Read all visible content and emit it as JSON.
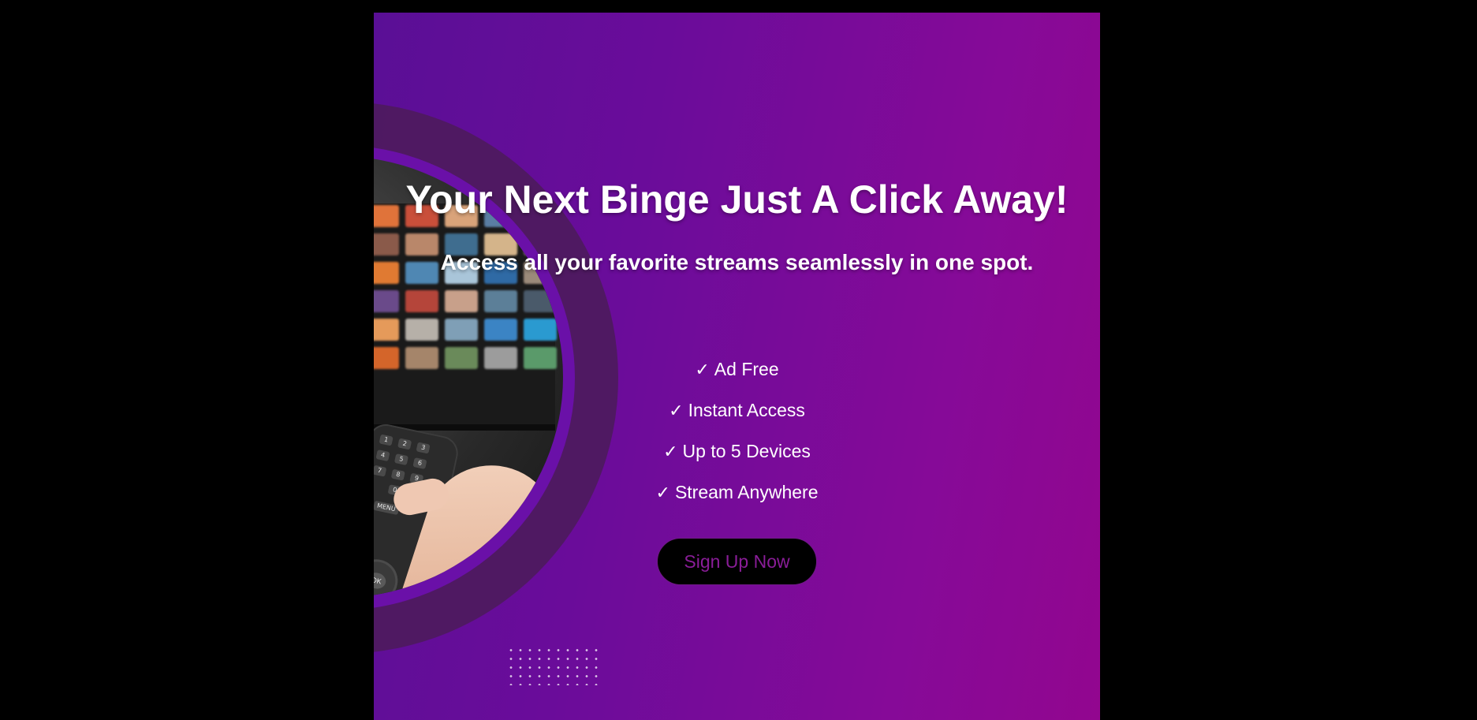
{
  "banner": {
    "headline": "Your Next Binge Just A Click Away!",
    "subheadline": "Access all your favorite streams seamlessly in one spot.",
    "features": [
      {
        "check": "✓",
        "label": "Ad Free"
      },
      {
        "check": "✓",
        "label": "Instant Access"
      },
      {
        "check": "✓",
        "label": "Up to 5 Devices"
      },
      {
        "check": "✓",
        "label": "Stream Anywhere"
      }
    ],
    "cta_label": "Sign Up Now"
  },
  "remote_labels": {
    "k1": "1",
    "k2": "2",
    "k3": "3",
    "k4": "4",
    "k5": "5",
    "k6": "6",
    "k7": "7",
    "k8": "8",
    "k9": "9",
    "k0": "0",
    "menu": "MENU",
    "ok": "OK"
  },
  "colors": {
    "page_background": "#000000",
    "gradient_start": "#5a0f96",
    "gradient_end": "#92068f",
    "ring": "#4e1a5f",
    "text": "#ffffff",
    "cta_background": "#000000",
    "cta_text": "#8a1d98"
  },
  "icons": {
    "check": "check-icon",
    "photo": "tv-remote-photo"
  }
}
